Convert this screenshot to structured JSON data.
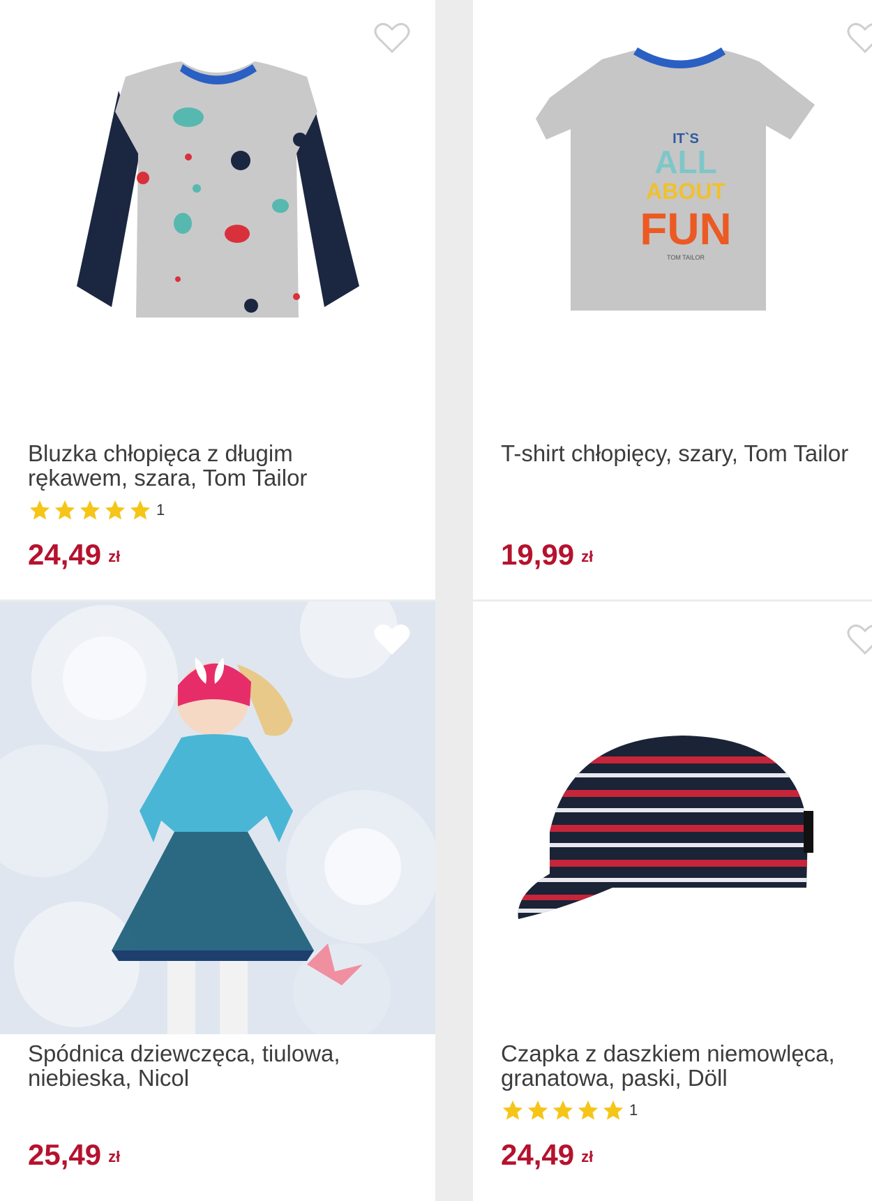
{
  "products": [
    {
      "title": "Bluzka chłopięca z długim\nrękawem, szara, Tom Tailor",
      "rating_count": "1",
      "stars": 5,
      "price": "24,49",
      "currency": "zł",
      "image": "grey-longsleeve-shirt-image",
      "favorite_icon": "heart-outline-icon"
    },
    {
      "title": "T-shirt chłopięcy, szary, Tom Tailor",
      "price": "19,99",
      "currency": "zł",
      "image": "grey-tshirt-image",
      "print_text": [
        "IT`S",
        "ALL",
        "ABOUT",
        "FUN",
        "TOM TAILOR"
      ],
      "favorite_icon": "heart-outline-icon"
    },
    {
      "title": "Spódnica dziewczęca, tiulowa,\nniebieska, Nicol",
      "price": "25,49",
      "currency": "zł",
      "image": "girl-tulle-skirt-photo",
      "favorite_icon": "heart-outline-icon"
    },
    {
      "title": "Czapka z daszkiem niemowlęca,\ngranatowa, paski, Döll",
      "rating_count": "1",
      "stars": 5,
      "price": "24,49",
      "currency": "zł",
      "image": "striped-cap-image",
      "favorite_icon": "heart-outline-icon"
    }
  ],
  "colors": {
    "price": "#b5122e",
    "star": "#f5c518",
    "background": "#ececec",
    "card": "#ffffff"
  }
}
